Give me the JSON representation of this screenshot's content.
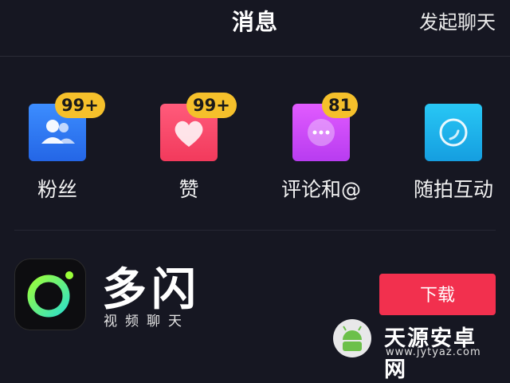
{
  "header": {
    "title": "消息",
    "start_chat": "发起聊天"
  },
  "tiles": [
    {
      "label": "粉丝",
      "badge": "99+",
      "icon": "fans-icon",
      "color": "#2f7dff"
    },
    {
      "label": "赞",
      "badge": "99+",
      "icon": "heart-icon",
      "color": "#ff4b6e"
    },
    {
      "label": "评论和@",
      "badge": "81",
      "icon": "comment-icon",
      "color": "#d54dff"
    },
    {
      "label": "随拍互动",
      "badge": "",
      "icon": "camera-interaction-icon",
      "color": "#1fb9ef"
    }
  ],
  "ad": {
    "app_name": "多闪",
    "app_subtitle": "视频聊天",
    "download_label": "下载",
    "logo_icon": "duoshan-logo-icon"
  },
  "watermark": {
    "text": "天源安卓网",
    "url": "www.jytyaz.com"
  }
}
